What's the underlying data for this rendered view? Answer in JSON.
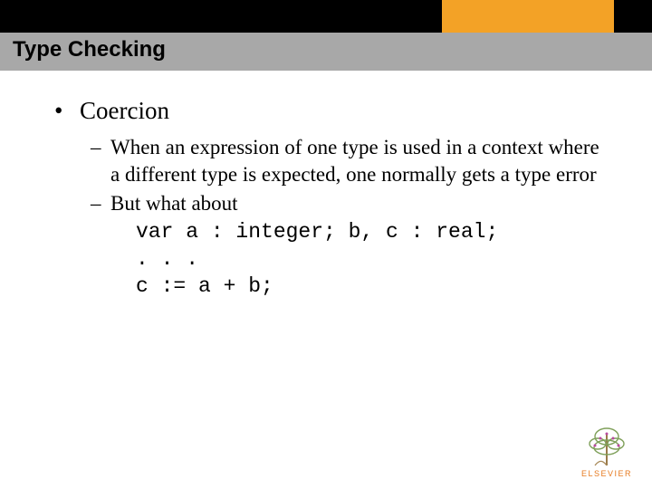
{
  "header": {
    "title": "Type Checking"
  },
  "bullet": {
    "marker": "•",
    "label": "Coercion"
  },
  "sub": {
    "marker": "–",
    "item1": "When an expression of one type is used in a context where a different type is expected, one normally gets a type error",
    "item2": "But what about"
  },
  "code": {
    "line1": "var a : integer; b, c : real;",
    "line2": ". . .",
    "line3": "c := a + b;"
  },
  "footer": {
    "publisher": "ELSEVIER"
  }
}
